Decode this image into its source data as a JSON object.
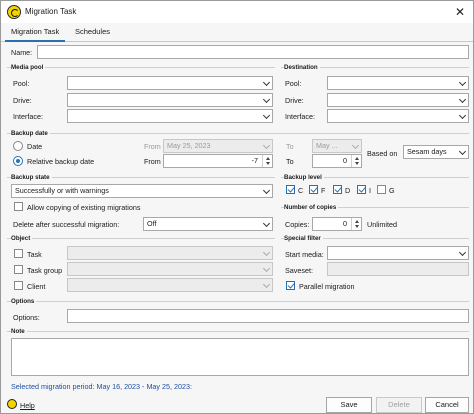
{
  "window": {
    "title": "Migration Task",
    "close_glyph": "✕"
  },
  "tabs": [
    {
      "label": "Migration Task",
      "active": true
    },
    {
      "label": "Schedules",
      "active": false
    }
  ],
  "name": {
    "label": "Name:",
    "value": ""
  },
  "media_pool": {
    "section": "Media pool",
    "pool_label": "Pool:",
    "pool_value": "",
    "drive_label": "Drive:",
    "drive_value": "",
    "interface_label": "Interface:",
    "interface_value": ""
  },
  "destination": {
    "section": "Destination",
    "pool_label": "Pool:",
    "pool_value": "",
    "drive_label": "Drive:",
    "drive_value": "",
    "interface_label": "Interface:",
    "interface_value": ""
  },
  "backup_date": {
    "section": "Backup date",
    "date_label": "Date",
    "relative_label": "Relative backup date",
    "from_label": "From",
    "from_date": "May 25, 2023",
    "to_label": "To",
    "to_date": "May ...",
    "from_label2": "From",
    "from_relative": "-7",
    "to_label2": "To",
    "to_relative": "0",
    "based_on_label": "Based on",
    "based_on_value": "Sesam days"
  },
  "backup_state": {
    "section": "Backup state",
    "state_value": "Successfully or with warnings",
    "allow_copy_label": "Allow copying of existing migrations",
    "delete_label": "Delete after successful migration:",
    "delete_value": "Off"
  },
  "backup_level": {
    "section": "Backup level",
    "levels": [
      {
        "label": "C",
        "checked": true
      },
      {
        "label": "F",
        "checked": true
      },
      {
        "label": "D",
        "checked": true
      },
      {
        "label": "I",
        "checked": true
      },
      {
        "label": "G",
        "checked": false
      }
    ]
  },
  "copies": {
    "section": "Number of copies",
    "label": "Copies:",
    "value": "0",
    "unlimited_label": "Unlimited"
  },
  "object": {
    "section": "Object",
    "task_label": "Task",
    "task_group_label": "Task group",
    "client_label": "Client"
  },
  "special_filter": {
    "section": "Special filter",
    "start_media_label": "Start media:",
    "saveset_label": "Saveset:",
    "parallel_label": "Parallel migration"
  },
  "options": {
    "section": "Options",
    "label": "Options:",
    "value": ""
  },
  "note": {
    "section": "Note"
  },
  "period_text": "Selected migration period: May 16, 2023 - May 25, 2023:",
  "footer": {
    "help_label": "Help",
    "save_label": "Save",
    "delete_label": "Delete",
    "cancel_label": "Cancel"
  },
  "colors": {
    "accent": "#2b6fb3",
    "period_text": "#1e4fa0",
    "app_icon": "#f3d400"
  }
}
